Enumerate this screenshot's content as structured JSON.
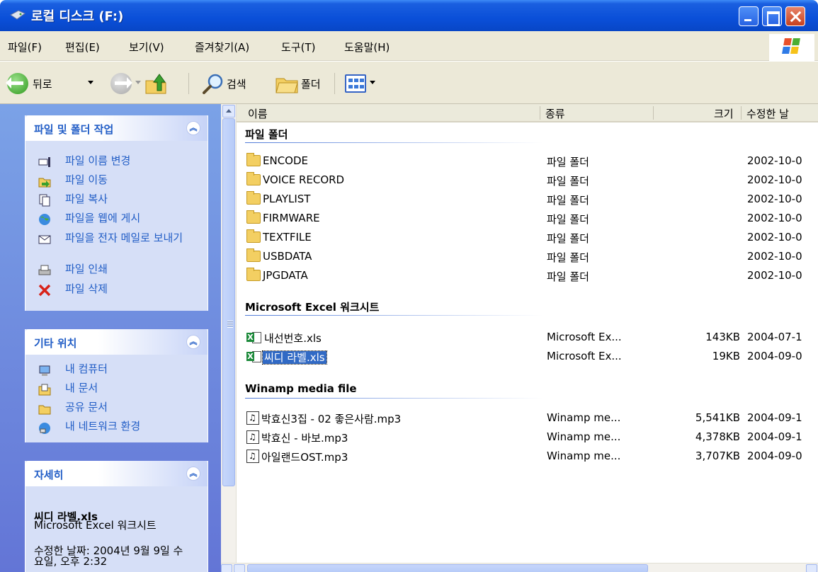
{
  "window": {
    "title": "로컬 디스크 (F:)"
  },
  "menu": [
    "파일(F)",
    "편집(E)",
    "보기(V)",
    "즐겨찾기(A)",
    "도구(T)",
    "도움말(H)"
  ],
  "toolbar": {
    "back_label": "뒤로",
    "search_label": "검색",
    "folders_label": "폴더"
  },
  "sidebar": {
    "tasks": {
      "header": "파일 및 폴더 작업",
      "items": [
        "파일 이름 변경",
        "파일 이동",
        "파일 복사",
        "파일을 웹에 게시",
        "파일을 전자 메일로 보내기",
        "파일 인쇄",
        "파일 삭제"
      ]
    },
    "places": {
      "header": "기타 위치",
      "items": [
        "내 컴퓨터",
        "내 문서",
        "공유 문서",
        "내 네트워크 환경"
      ]
    },
    "details": {
      "header": "자세히",
      "name": "씨디 라벨.xls",
      "type": "Microsoft Excel 워크시트",
      "modified": "수정한 날짜: 2004년 9월 9일 수요일, 오후 2:32"
    }
  },
  "columns": {
    "name": "이름",
    "type": "종류",
    "size": "크기",
    "modified": "수정한 날"
  },
  "groups": [
    {
      "title": "파일 폴더",
      "rows": [
        {
          "name": "ENCODE",
          "type": "파일 폴더",
          "size": "",
          "date": "2002-10-0"
        },
        {
          "name": "VOICE RECORD",
          "type": "파일 폴더",
          "size": "",
          "date": "2002-10-0"
        },
        {
          "name": "PLAYLIST",
          "type": "파일 폴더",
          "size": "",
          "date": "2002-10-0"
        },
        {
          "name": "FIRMWARE",
          "type": "파일 폴더",
          "size": "",
          "date": "2002-10-0"
        },
        {
          "name": "TEXTFILE",
          "type": "파일 폴더",
          "size": "",
          "date": "2002-10-0"
        },
        {
          "name": "USBDATA",
          "type": "파일 폴더",
          "size": "",
          "date": "2002-10-0"
        },
        {
          "name": "JPGDATA",
          "type": "파일 폴더",
          "size": "",
          "date": "2002-10-0"
        }
      ]
    },
    {
      "title": "Microsoft Excel 워크시트",
      "rows": [
        {
          "name": "내선번호.xls",
          "type": "Microsoft Ex...",
          "size": "143KB",
          "date": "2004-07-1"
        },
        {
          "name": "씨디 라벨.xls",
          "type": "Microsoft Ex...",
          "size": "19KB",
          "date": "2004-09-0",
          "selected": true
        }
      ]
    },
    {
      "title": "Winamp media file",
      "rows": [
        {
          "name": "박효신3집 - 02 좋은사람.mp3",
          "type": "Winamp me...",
          "size": "5,541KB",
          "date": "2004-09-1"
        },
        {
          "name": "박효신 - 바보.mp3",
          "type": "Winamp me...",
          "size": "4,378KB",
          "date": "2004-09-1"
        },
        {
          "name": "아일랜드OST.mp3",
          "type": "Winamp me...",
          "size": "3,707KB",
          "date": "2004-09-0"
        }
      ]
    }
  ]
}
